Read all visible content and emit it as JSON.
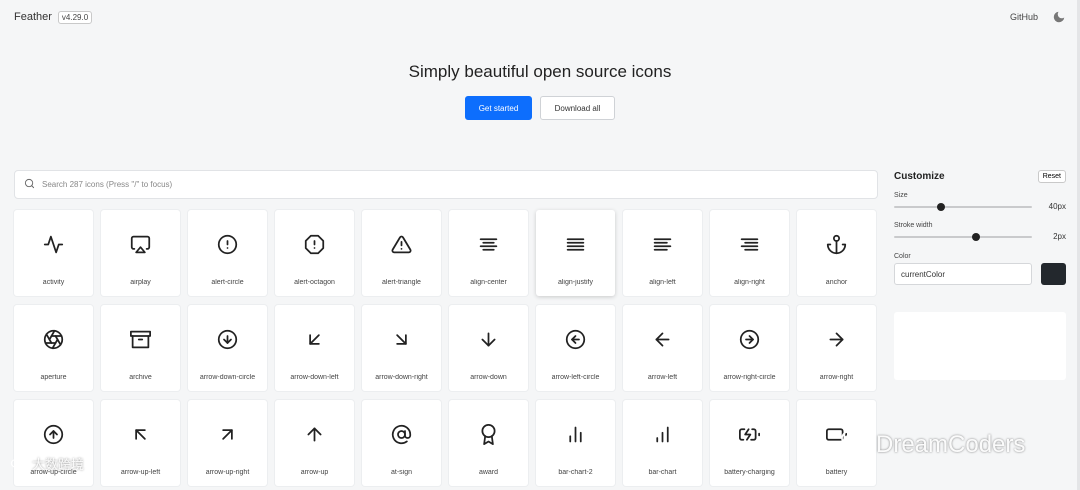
{
  "header": {
    "brand": "Feather",
    "version": "v4.29.0",
    "github_label": "GitHub",
    "theme_icon": "moon-icon"
  },
  "hero": {
    "title": "Simply beautiful open source icons",
    "primary_label": "Get started",
    "secondary_label": "Download all",
    "accent_color": "#0d6efd"
  },
  "search": {
    "placeholder": "Search 287 icons (Press \"/\" to focus)",
    "value": ""
  },
  "icons": [
    {
      "name": "activity"
    },
    {
      "name": "airplay"
    },
    {
      "name": "alert-circle"
    },
    {
      "name": "alert-octagon"
    },
    {
      "name": "alert-triangle"
    },
    {
      "name": "align-center"
    },
    {
      "name": "align-justify"
    },
    {
      "name": "align-left"
    },
    {
      "name": "align-right"
    },
    {
      "name": "anchor"
    },
    {
      "name": "aperture"
    },
    {
      "name": "archive"
    },
    {
      "name": "arrow-down-circle"
    },
    {
      "name": "arrow-down-left"
    },
    {
      "name": "arrow-down-right"
    },
    {
      "name": "arrow-down"
    },
    {
      "name": "arrow-left-circle"
    },
    {
      "name": "arrow-left"
    },
    {
      "name": "arrow-right-circle"
    },
    {
      "name": "arrow-right"
    },
    {
      "name": "arrow-up-circle"
    },
    {
      "name": "arrow-up-left"
    },
    {
      "name": "arrow-up-right"
    },
    {
      "name": "arrow-up"
    },
    {
      "name": "at-sign"
    },
    {
      "name": "award"
    },
    {
      "name": "bar-chart-2"
    },
    {
      "name": "bar-chart"
    },
    {
      "name": "battery-charging"
    },
    {
      "name": "battery"
    }
  ],
  "customize": {
    "title": "Customize",
    "reset_label": "Reset",
    "size_label": "Size",
    "size_value": "40px",
    "size_fraction": 0.33,
    "stroke_label": "Stroke width",
    "stroke_value": "2px",
    "stroke_fraction": 0.6,
    "color_label": "Color",
    "color_value": "currentColor",
    "swatch_color": "#23282d"
  },
  "watermarks": {
    "left_text": "大数跨境",
    "right_text": "DreamCoders"
  }
}
